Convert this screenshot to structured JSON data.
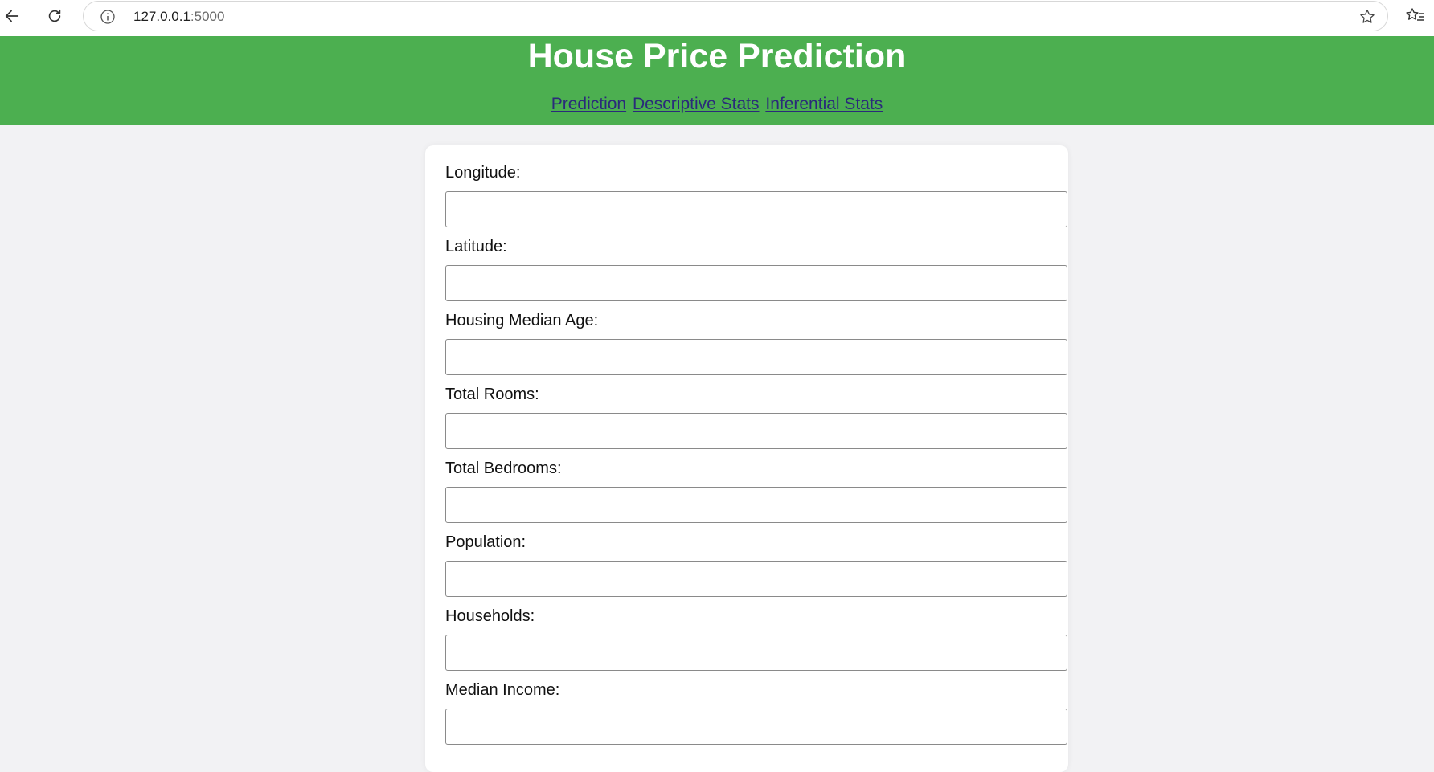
{
  "browser": {
    "url_host": "127.0.0.1",
    "url_port": ":5000",
    "icons": {
      "back": "arrow-left-icon",
      "reload": "reload-icon",
      "info": "info-icon",
      "bookmark": "star-icon",
      "favorites": "favorites-icon"
    }
  },
  "header": {
    "title": "House Price Prediction",
    "background_color": "#4caf50",
    "nav": [
      {
        "label": "Prediction"
      },
      {
        "label": "Descriptive Stats"
      },
      {
        "label": "Inferential Stats"
      }
    ]
  },
  "form": {
    "fields": [
      {
        "label": "Longitude:",
        "value": ""
      },
      {
        "label": "Latitude:",
        "value": ""
      },
      {
        "label": "Housing Median Age:",
        "value": ""
      },
      {
        "label": "Total Rooms:",
        "value": ""
      },
      {
        "label": "Total Bedrooms:",
        "value": ""
      },
      {
        "label": "Population:",
        "value": ""
      },
      {
        "label": "Households:",
        "value": ""
      },
      {
        "label": "Median Income:",
        "value": ""
      }
    ]
  }
}
